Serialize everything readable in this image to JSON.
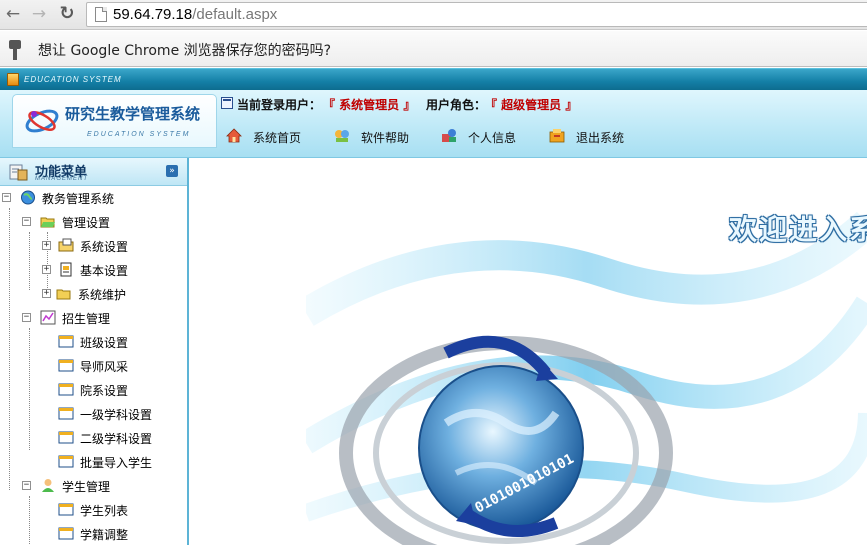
{
  "browser": {
    "url_host": "59.64.79.18",
    "url_path": "/default.aspx",
    "infobar_text": "想让 Google Chrome 浏览器保存您的密码吗?"
  },
  "app": {
    "strip_text": "EDUCATION SYSTEM",
    "logo_title": "研究生教学管理系统",
    "logo_subtitle": "EDUCATION SYSTEM",
    "user_label": "当前登录用户：",
    "user_value": "『 系统管理员 』",
    "role_label": "用户角色：",
    "role_value": "『 超级管理员 』",
    "nav": [
      {
        "label": "系统首页",
        "icon": "home-icon"
      },
      {
        "label": "软件帮助",
        "icon": "help-icon"
      },
      {
        "label": "个人信息",
        "icon": "user-info-icon"
      },
      {
        "label": "退出系统",
        "icon": "logout-icon"
      }
    ]
  },
  "menu": {
    "title": "功能菜单",
    "subtitle": "MANAGEMENT",
    "tree": [
      {
        "label": "教务管理系统",
        "icon": "globe-icon",
        "level": 0,
        "toggle": "-"
      },
      {
        "label": "管理设置",
        "icon": "folder-open-icon",
        "level": 1,
        "toggle": "-"
      },
      {
        "label": "系统设置",
        "icon": "settings-folder-icon",
        "level": 2,
        "toggle": "+"
      },
      {
        "label": "基本设置",
        "icon": "document-icon",
        "level": 2,
        "toggle": "+"
      },
      {
        "label": "系统维护",
        "icon": "folder-icon",
        "level": 2,
        "toggle": "+"
      },
      {
        "label": "招生管理",
        "icon": "chart-icon",
        "level": 1,
        "toggle": "-"
      },
      {
        "label": "班级设置",
        "icon": "window-icon",
        "level": 2,
        "toggle": ""
      },
      {
        "label": "导师风采",
        "icon": "window-icon",
        "level": 2,
        "toggle": ""
      },
      {
        "label": "院系设置",
        "icon": "window-icon",
        "level": 2,
        "toggle": ""
      },
      {
        "label": "一级学科设置",
        "icon": "window-icon",
        "level": 2,
        "toggle": ""
      },
      {
        "label": "二级学科设置",
        "icon": "window-icon",
        "level": 2,
        "toggle": ""
      },
      {
        "label": "批量导入学生",
        "icon": "window-icon",
        "level": 2,
        "toggle": ""
      },
      {
        "label": "学生管理",
        "icon": "person-icon",
        "level": 1,
        "toggle": "-"
      },
      {
        "label": "学生列表",
        "icon": "window-icon",
        "level": 2,
        "toggle": ""
      },
      {
        "label": "学籍调整",
        "icon": "window-icon",
        "level": 2,
        "toggle": ""
      }
    ]
  },
  "content": {
    "welcome_text": "欢迎进入系统"
  },
  "colors": {
    "banner": "#147fa6",
    "header_bg": "#bfe9f7",
    "accent_red": "#c00000",
    "sidebar_border": "#5db4d6"
  }
}
